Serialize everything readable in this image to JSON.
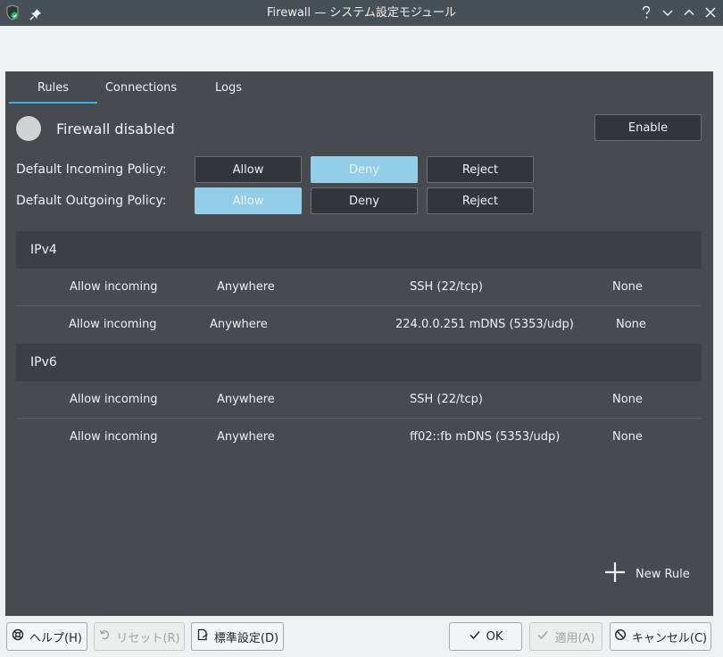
{
  "window": {
    "title": "Firewall — システム設定モジュール"
  },
  "tabs": [
    {
      "label": "Rules"
    },
    {
      "label": "Connections"
    },
    {
      "label": "Logs"
    }
  ],
  "status": {
    "text": "Firewall disabled",
    "enable_label": "Enable"
  },
  "policy": {
    "incoming_label": "Default Incoming Policy:",
    "outgoing_label": "Default Outgoing Policy:",
    "options": [
      "Allow",
      "Deny",
      "Reject"
    ],
    "incoming_selected": "Deny",
    "outgoing_selected": "Allow"
  },
  "rules": {
    "ipv4": {
      "label": "IPv4",
      "rows": [
        {
          "action": "Allow incoming",
          "from": "Anywhere",
          "to": "SSH (22/tcp)",
          "log": "None"
        },
        {
          "action": "Allow incoming",
          "from": "Anywhere",
          "to": "224.0.0.251 mDNS (5353/udp)",
          "log": "None"
        }
      ]
    },
    "ipv6": {
      "label": "IPv6",
      "rows": [
        {
          "action": "Allow incoming",
          "from": "Anywhere",
          "to": "SSH (22/tcp)",
          "log": "None"
        },
        {
          "action": "Allow incoming",
          "from": "Anywhere",
          "to": "ff02::fb mDNS (5353/udp)",
          "log": "None"
        }
      ]
    }
  },
  "new_rule_label": "New Rule",
  "footer": {
    "help": "ヘルプ(H)",
    "reset": "リセット(R)",
    "defaults": "標準設定(D)",
    "ok": "OK",
    "apply": "適用(A)",
    "cancel": "キャンセル(C)"
  },
  "colors": {
    "accent": "#3daee9",
    "selected_policy": "#93cee9",
    "panel_bg": "#464b50",
    "button_bg": "#31363b"
  }
}
